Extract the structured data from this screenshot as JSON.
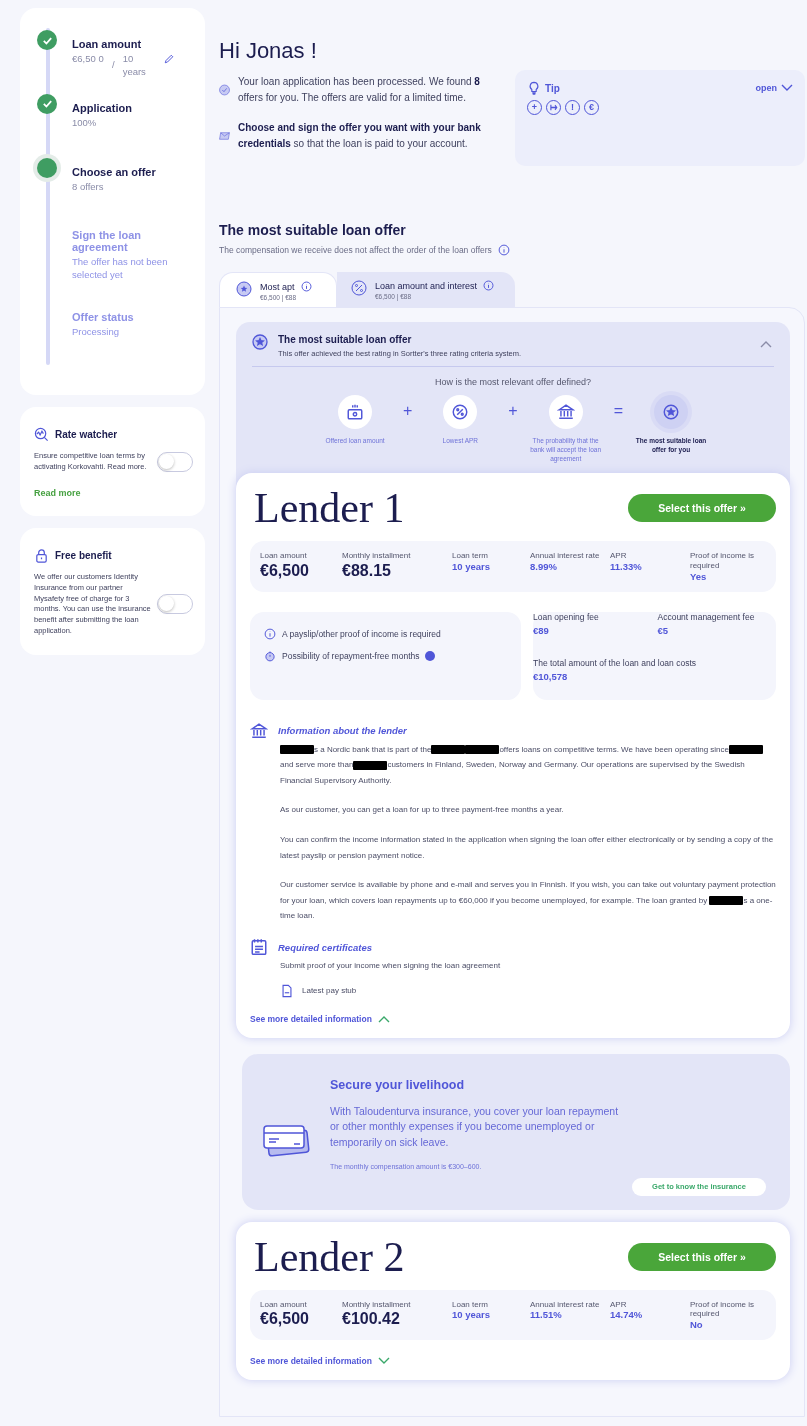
{
  "steps": [
    {
      "title": "Loan amount",
      "detail": [
        "€6,50 0",
        "10 years"
      ],
      "separator": "/",
      "completed": true,
      "selected": false,
      "editable": true
    },
    {
      "title": "Application",
      "detail": [
        "100%"
      ],
      "completed": true,
      "selected": false
    },
    {
      "title": "Choose an offer",
      "detail": [
        "8 offers"
      ],
      "completed": false,
      "selected": true
    },
    {
      "title": "Sign the loan agreement",
      "detail": [
        "The offer has not been selected yet"
      ],
      "completed": false,
      "selected": false
    },
    {
      "title": "Offer status",
      "detail": [
        "Processing"
      ],
      "completed": false,
      "selected": false
    }
  ],
  "side_cards": [
    {
      "title": "Rate watcher",
      "text": "Ensure competitive loan terms by activating Korkovahti. Read more.",
      "on": false,
      "link": "Read more"
    },
    {
      "title": "Free benefit",
      "text": "We offer our customers Identity Insurance from our partner Mysafety free of charge for 3 months. You can use the insurance benefit after submitting the loan application.",
      "on": false
    }
  ],
  "greeting": "Hi Jonas !",
  "intro": [
    "Your loan application has been processed. We found **8** offers for you. The offers are valid for a limited time.",
    "**Choose and sign the offer you want with your bank credentials** so that the loan is paid to your account."
  ],
  "tip": {
    "title": "Tip",
    "toggle": "open",
    "icons": [
      "+",
      "↦",
      "!",
      "€"
    ]
  },
  "section": {
    "title": "The most suitable loan offer",
    "subtitle": "The compensation we receive does not affect the order of the loan offers"
  },
  "tabs": [
    {
      "label": "Most apt",
      "sub": "€6,500 | €88",
      "selected": true
    },
    {
      "label": "Loan amount and interest",
      "sub": "€6,500 | €88",
      "selected": false
    }
  ],
  "explainer": {
    "title": "The most suitable loan offer",
    "text": "This offer achieved the best rating in Sortter's three rating criteria system.",
    "question": "How is the most relevant offer defined?",
    "expanded": true,
    "criteria": [
      {
        "label": "Offered loan amount",
        "kind": "factor"
      },
      {
        "label": "Lowest APR",
        "kind": "factor"
      },
      {
        "label": "The probability that the bank will accept the loan agreement",
        "kind": "factor"
      },
      {
        "label": "The most suitable loan offer for you",
        "kind": "result"
      }
    ],
    "operators": [
      "+",
      "+",
      "="
    ]
  },
  "offers": [
    {
      "lender": "Lender 1",
      "button": "Select this offer »",
      "metrics": [
        {
          "label": "Loan amount",
          "value": "€6,500",
          "kind": "big"
        },
        {
          "label": "Monthly installment",
          "value": "€88.15",
          "kind": "big"
        },
        {
          "label": "Loan term",
          "value": "10 years",
          "kind": "small"
        },
        {
          "label": "Annual interest rate",
          "value": "8.99%",
          "kind": "small"
        },
        {
          "label": "APR",
          "value": "11.33%",
          "kind": "small"
        },
        {
          "label": "Proof of income is required",
          "value": "Yes",
          "kind": "small"
        }
      ],
      "features": [
        "A payslip/other proof of income is required",
        "Possibility of repayment-free months"
      ],
      "fees": [
        {
          "label": "Loan opening fee",
          "value": "€89"
        },
        {
          "label": "Account management fee",
          "value": "€5"
        },
        {
          "label": "The total amount of the loan and loan costs",
          "value": "€10,578"
        }
      ],
      "info_title": "Information about the lender",
      "paragraphs": [
        [
          {
            "kind": "redaction"
          },
          {
            "kind": "text",
            "text": "s a Nordic bank that is part of the"
          },
          {
            "kind": "redaction"
          },
          {
            "kind": "redaction"
          },
          {
            "kind": "text",
            "text": "offers loans on competitive terms. We have been operating since"
          },
          {
            "kind": "redaction"
          },
          {
            "kind": "text",
            "text": "and serve more than"
          },
          {
            "kind": "redaction"
          },
          {
            "kind": "text",
            "text": "customers in Finland, Sweden, Norway and Germany. Our operations are supervised by the Swedish Financial Supervisory Authority."
          }
        ],
        [
          {
            "kind": "text",
            "text": "As our customer, you can get a loan for up to three payment-free months a year."
          }
        ],
        [
          {
            "kind": "text",
            "text": "You can confirm the income information stated in the application when signing the loan offer either electronically or by sending a copy of the latest payslip or pension payment notice."
          }
        ],
        [
          {
            "kind": "text",
            "text": "Our customer service is available by phone and e-mail and serves you in Finnish. If you wish, you can take out voluntary payment protection for your loan, which covers loan repayments up to €60,000 if you become unemployed, for example. The loan granted by "
          },
          {
            "kind": "redaction"
          },
          {
            "kind": "text",
            "text": "s a one-time loan."
          }
        ]
      ],
      "cert_title": "Required certificates",
      "cert_text": "Submit proof of your income when signing the loan agreement",
      "cert_file": "Latest pay stub",
      "more": "See more detailed information",
      "expanded": true
    },
    {
      "lender": "Lender 2",
      "button": "Select this offer »",
      "metrics": [
        {
          "label": "Loan amount",
          "value": "€6,500",
          "kind": "big"
        },
        {
          "label": "Monthly installment",
          "value": "€100.42",
          "kind": "big"
        },
        {
          "label": "Loan term",
          "value": "10 years",
          "kind": "small"
        },
        {
          "label": "Annual interest rate",
          "value": "11.51%",
          "kind": "small"
        },
        {
          "label": "APR",
          "value": "14.74%",
          "kind": "small"
        },
        {
          "label": "Proof of income is required",
          "value": "No",
          "kind": "small"
        }
      ],
      "more": "See more detailed information",
      "expanded": false
    }
  ],
  "insurance": {
    "title": "Secure your livelihood",
    "text": "With Taloudenturva insurance, you cover your loan repayment or other monthly expenses if you become unemployed or temporarily on sick leave.",
    "note": "The monthly compensation amount is €300–600.",
    "button": "Get to know the insurance"
  }
}
